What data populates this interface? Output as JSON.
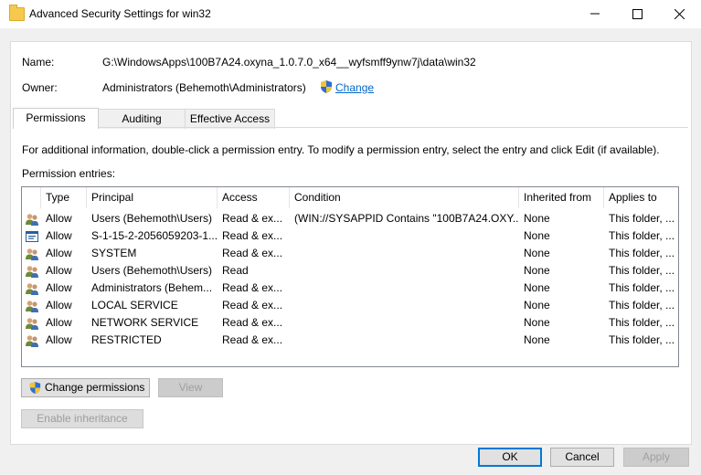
{
  "window": {
    "title": "Advanced Security Settings for win32"
  },
  "fields": {
    "name_label": "Name:",
    "name_value": "G:\\WindowsApps\\100B7A24.oxyna_1.0.7.0_x64__wyfsmff9ynw7j\\data\\win32",
    "owner_label": "Owner:",
    "owner_value": "Administrators (Behemoth\\Administrators)",
    "change_link": "Change"
  },
  "tabs": [
    {
      "label": "Permissions",
      "active": true
    },
    {
      "label": "Auditing",
      "active": false
    },
    {
      "label": "Effective Access",
      "active": false
    }
  ],
  "info_text": "For additional information, double-click a permission entry. To modify a permission entry, select the entry and click Edit (if available).",
  "entries_label": "Permission entries:",
  "columns": [
    "Type",
    "Principal",
    "Access",
    "Condition",
    "Inherited from",
    "Applies to"
  ],
  "rows": [
    {
      "icon": "group-icon",
      "type": "Allow",
      "principal": "Users (Behemoth\\Users)",
      "access": "Read & ex...",
      "condition": "(WIN://SYSAPPID Contains \"100B7A24.OXY...",
      "inherited": "None",
      "applies": "This folder, ..."
    },
    {
      "icon": "app-sid-icon",
      "type": "Allow",
      "principal": "S-1-15-2-2056059203-1...",
      "access": "Read & ex...",
      "condition": "",
      "inherited": "None",
      "applies": "This folder, ..."
    },
    {
      "icon": "group-icon",
      "type": "Allow",
      "principal": "SYSTEM",
      "access": "Read & ex...",
      "condition": "",
      "inherited": "None",
      "applies": "This folder, ..."
    },
    {
      "icon": "group-icon",
      "type": "Allow",
      "principal": "Users (Behemoth\\Users)",
      "access": "Read",
      "condition": "",
      "inherited": "None",
      "applies": "This folder, ..."
    },
    {
      "icon": "group-icon",
      "type": "Allow",
      "principal": "Administrators (Behem...",
      "access": "Read & ex...",
      "condition": "",
      "inherited": "None",
      "applies": "This folder, ..."
    },
    {
      "icon": "group-icon",
      "type": "Allow",
      "principal": "LOCAL SERVICE",
      "access": "Read & ex...",
      "condition": "",
      "inherited": "None",
      "applies": "This folder, ..."
    },
    {
      "icon": "group-icon",
      "type": "Allow",
      "principal": "NETWORK SERVICE",
      "access": "Read & ex...",
      "condition": "",
      "inherited": "None",
      "applies": "This folder, ..."
    },
    {
      "icon": "group-icon",
      "type": "Allow",
      "principal": "RESTRICTED",
      "access": "Read & ex...",
      "condition": "",
      "inherited": "None",
      "applies": "This folder, ..."
    }
  ],
  "buttons": {
    "change_permissions": "Change permissions",
    "view": "View",
    "enable_inheritance": "Enable inheritance",
    "ok": "OK",
    "cancel": "Cancel",
    "apply": "Apply"
  },
  "colors": {
    "link": "#0066cc",
    "accent": "#0078d7"
  }
}
